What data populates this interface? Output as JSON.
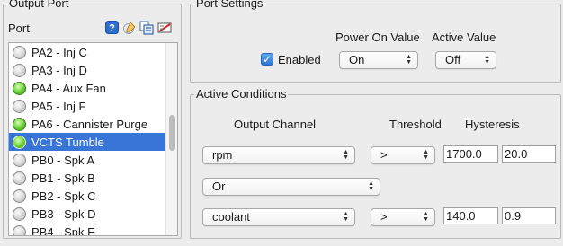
{
  "output_port": {
    "title": "Output Port",
    "port_label": "Port",
    "icons": [
      "help-icon",
      "edit-icon",
      "copy-icon",
      "clear-icon"
    ],
    "items": [
      {
        "label": "PA2 - Inj C",
        "state": "off"
      },
      {
        "label": "PA3 - Inj D",
        "state": "off"
      },
      {
        "label": "PA4 - Aux Fan",
        "state": "on"
      },
      {
        "label": "PA5 - Inj F",
        "state": "off"
      },
      {
        "label": "PA6 - Cannister Purge",
        "state": "on"
      },
      {
        "label": "VCTS Tumble",
        "state": "on",
        "selected": true
      },
      {
        "label": "PB0 - Spk A",
        "state": "off"
      },
      {
        "label": "PB1 - Spk B",
        "state": "off"
      },
      {
        "label": "PB2 - Spk C",
        "state": "off"
      },
      {
        "label": "PB3 - Spk D",
        "state": "off"
      },
      {
        "label": "PB4 - Spk E",
        "state": "off"
      }
    ]
  },
  "port_settings": {
    "title": "Port Settings",
    "enabled_label": "Enabled",
    "enabled_checked": true,
    "power_on_header": "Power On Value",
    "active_value_header": "Active Value",
    "power_on_value": "On",
    "active_value": "Off"
  },
  "active_conditions": {
    "title": "Active Conditions",
    "headers": {
      "output_channel": "Output Channel",
      "threshold": "Threshold",
      "hysteresis": "Hysteresis"
    },
    "condition1": {
      "channel": "rpm",
      "operator": ">",
      "threshold": "1700.0",
      "hysteresis": "20.0"
    },
    "logic": "Or",
    "condition2": {
      "channel": "coolant",
      "operator": ">",
      "threshold": "140.0",
      "hysteresis": "0.9"
    }
  },
  "colors": {
    "selection": "#3875d7",
    "led_on": "#6fd23a",
    "led_off": "#d8d8d8",
    "checkbox": "#2f76d3"
  }
}
